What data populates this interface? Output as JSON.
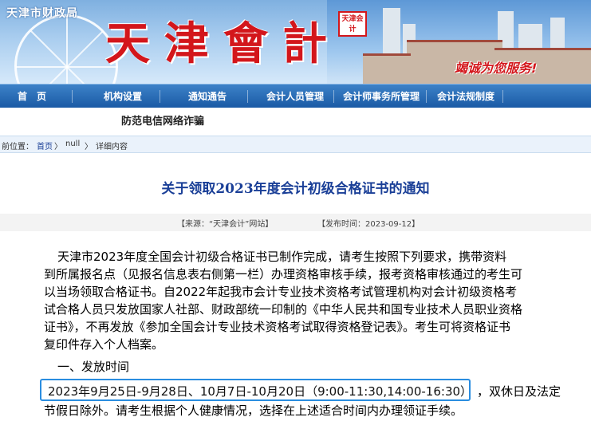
{
  "banner": {
    "agency": "天津市财政局",
    "title": "天津會計",
    "seal": "天津会计",
    "slogan": "竭诚为您服务!"
  },
  "nav": {
    "items": [
      "首　页",
      "机构设置",
      "通知通告",
      "会计人员管理",
      "会计师事务所管理",
      "会计法规制度"
    ]
  },
  "subbar": {
    "fraud_text": "防范电信网络诈骗"
  },
  "breadcrumb": {
    "prefix": "前位置：",
    "home": "首页",
    "sep1": "〉",
    "mid": "null",
    "sep2": "〉",
    "current": "详细内容"
  },
  "article": {
    "title": "关于领取2023年度会计初级合格证书的通知",
    "source": "【来源：“天津会计”网站】",
    "date": "【发布时间：2023-09-12】",
    "paragraph_lines": [
      "天津市2023年度全国会计初级合格证书已制作完成，请考生按照下列要求，携带资料",
      "到所属报名点（见报名信息表右侧第一栏）办理资格审核手续，报考资格审核通过的考生可",
      "以当场领取合格证书。自2022年起我市会计专业技术资格考试管理机构对会计初级资格考",
      "试合格人员只发放国家人社部、财政部统一印制的《中华人民共和国专业技术人员职业资格",
      "证书》，不再发放《参加全国会计专业技术资格考试取得资格登记表》。考生可将资格证书",
      "复印件存入个人档案。"
    ],
    "section1": "一、发放时间",
    "time_highlight": "2023年9月25日-9月28日、10月7日-10月20日（9:00-11:30,14:00-16:30）",
    "time_rest": "，双休日及法定",
    "time_line2": "节假日除外。请考生根据个人健康情况，选择在上述适合时间内办理领证手续。"
  }
}
